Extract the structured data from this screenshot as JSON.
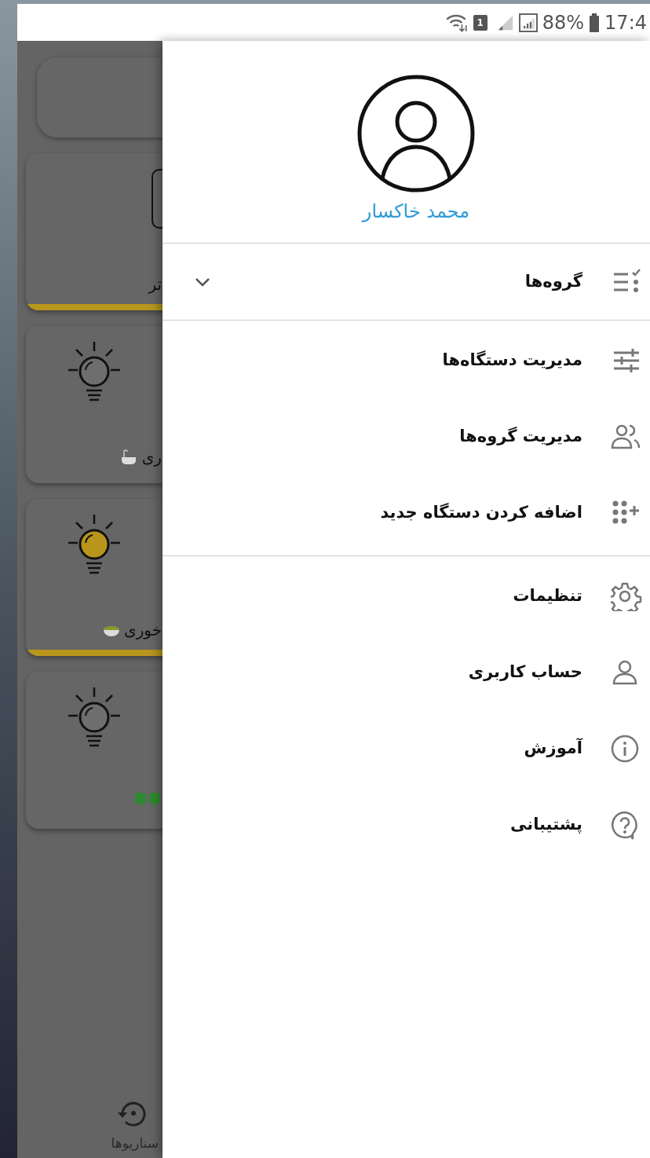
{
  "status_bar": {
    "sim_badge": "1",
    "battery": "88%",
    "time": "17:4"
  },
  "background_app": {
    "cards": [
      {
        "kind": "blank"
      },
      {
        "kind": "switch",
        "label": "تر",
        "on": true
      },
      {
        "kind": "light",
        "label": "ری",
        "on": false
      },
      {
        "kind": "light",
        "label": "خوری",
        "on": true
      },
      {
        "kind": "light",
        "on": false
      }
    ],
    "bottom_nav": {
      "label": "سناریوها"
    }
  },
  "drawer": {
    "user_name": "محمد خاکسار",
    "sections": [
      [
        {
          "label": "گروه‌ها",
          "expanded": false
        }
      ],
      [
        {
          "label": "مدیریت دستگاه‌ها"
        },
        {
          "label": "مدیریت گروه‌ها"
        },
        {
          "label": "اضافه کردن دستگاه جدید"
        }
      ],
      [
        {
          "label": "تنظیمات"
        },
        {
          "label": "حساب کاربری"
        },
        {
          "label": "آموزش"
        },
        {
          "label": "پشتیبانی"
        }
      ]
    ]
  }
}
